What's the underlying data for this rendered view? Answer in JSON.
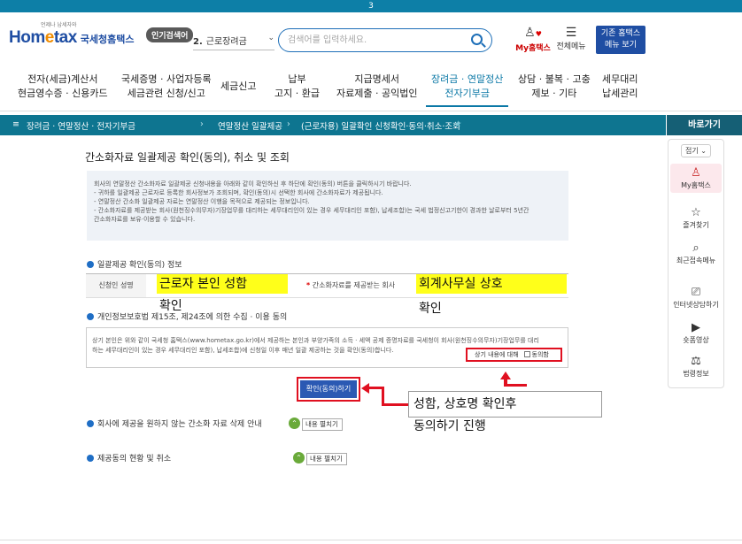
{
  "page_number": "3",
  "header": {
    "logo_sub": "언제나 납세자와",
    "logo_brand_a": "Hom",
    "logo_brand_b": "e",
    "logo_brand_c": "tax",
    "logo_text": "국세청홈택스",
    "popular_label": "인기검색어",
    "popular_rank": "2.",
    "popular_term": "근로장려금",
    "search_placeholder": "검색어를 입력하세요.",
    "my_label": "My홈택스",
    "menu_label": "전체메뉴",
    "basic_btn_line1": "기존 홈택스",
    "basic_btn_line2": "메뉴 보기"
  },
  "nav": [
    {
      "line1": "전자(세금)계산서",
      "line2": "현금영수증 · 신용카드"
    },
    {
      "line1": "국세증명 · 사업자등록",
      "line2": "세금관련 신청/신고"
    },
    {
      "line1": "세금신고",
      "line2": ""
    },
    {
      "line1": "납부",
      "line2": "고지 · 환급"
    },
    {
      "line1": "지급명세서",
      "line2": "자료제출 · 공익법인"
    },
    {
      "line1": "장려금 · 연말정산",
      "line2": "전자기부금"
    },
    {
      "line1": "상담 · 불복 · 고충",
      "line2": "제보 · 기타"
    },
    {
      "line1": "세무대리",
      "line2": "납세관리"
    }
  ],
  "breadcrumb": {
    "menu_glyph": "≡",
    "level1": "장려금 · 연말정산 · 전자기부금",
    "level2": "연말정산 일괄제공",
    "level3": "(근로자용) 일괄확인 신청확인·동의·취소·조회"
  },
  "quick": {
    "title": "바로가기",
    "fold": "접기",
    "items": [
      {
        "label": "My홈택스"
      },
      {
        "label": "즐겨찾기"
      },
      {
        "label": "최근접속메뉴"
      },
      {
        "label": "인터넷상담하기"
      },
      {
        "label": "숏폼영상"
      },
      {
        "label": "법령정보"
      }
    ]
  },
  "main": {
    "title": "간소화자료 일괄제공 확인(동의), 취소 및 조회",
    "info_lines": [
      "회사의 연말정산 간소화자료 일괄제공 신청내용을 아래와 같이 확인하신 후 하단에 확인(동의) 버튼을 클릭하시기 바랍니다.",
      "- 귀하를 일괄제공 근로자로 등록한 회사정보가 조회되며, 확인(동의)시 선택한 회사에 간소화자료가 제공됩니다.",
      "- 연말정산 간소화 일괄제공 자료는 연말정산 이행을 목적으로 제공되는 정보입니다.",
      "- 간소화자료를 제공받는 회사(원천징수의무자)기장업무를 대리하는 세무대리인이 있는 경우 세무대리인 포함), 납세조합)는 국세 법정신고기한이 경과한 날로부터 5년간",
      "  간소화자료를 보유·이용할 수 있습니다."
    ],
    "section1_title": "일괄제공 확인(동의) 정보",
    "applicant_label": "신청인 성명",
    "company_label": "간소화자료를 제공받는 회사",
    "required_mark": "*",
    "highlight1": "근로자 본인 성함",
    "note1": "확인",
    "highlight2": "회계사무실 상호",
    "note2": "확인",
    "section2_title": "개인정보보호법 제15조, 제24조에 의한 수집 · 이용 동의",
    "consent_lines": [
      "상기 본인은 위와 같이 국세청 홈택스(www.hometax.go.kr)에서 제공하는 본인과 부양가족의 소득 · 세액 공제 증명자료를 국세청이 회사(원천징수의무자)기장업무를 대리",
      "하는 세무대리인이 있는 경우 세무대리인 포함), 납세조합)에 신청일 이후 매년 일괄 제공하는 것을 확인(동의)합니다."
    ],
    "agree_question": "상기 내용에 대해",
    "agree_label": "동의함",
    "confirm_button": "확인(동의)하기",
    "callout_line1": "성함, 상호명 확인후",
    "callout_line2": "동의하기 진행",
    "section3_title": "회사에 제공을 원하지 않는 간소화 자료 삭제 안내",
    "section3_btn": "내용 펼치기",
    "section4_title": "제공동의 현황 및 취소",
    "section4_btn": "내용 펼치기"
  },
  "colors": {
    "topstrip": "#0d7fa7",
    "breadcrumb": "#0e7590",
    "highlight": "#ffff1a",
    "annotation_red": "#e01020",
    "confirm_blue": "#2b59b3"
  }
}
